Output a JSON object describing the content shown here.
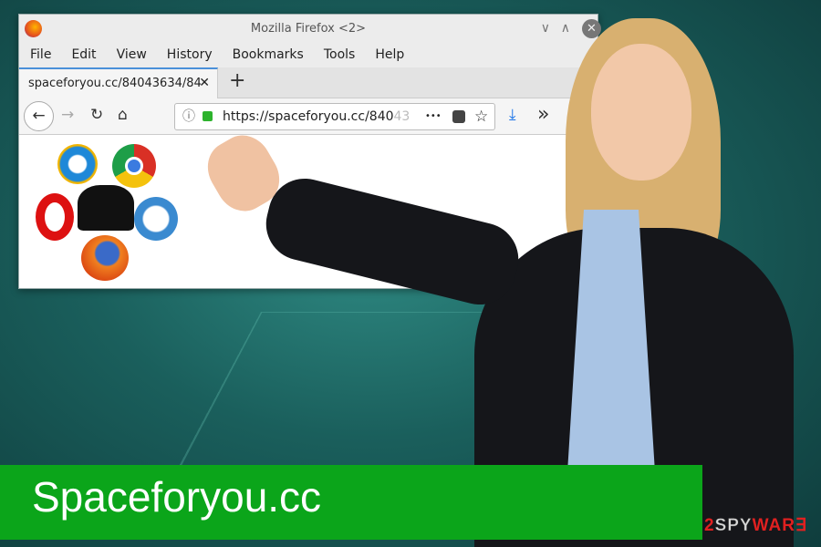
{
  "window": {
    "title": "Mozilla Firefox <2>",
    "min": "∨",
    "max": "∧",
    "close": "✕"
  },
  "menu": [
    "File",
    "Edit",
    "View",
    "History",
    "Bookmarks",
    "Tools",
    "Help"
  ],
  "tab": {
    "label": "spaceforyou.cc/84043634/84",
    "close": "✕",
    "new": "+"
  },
  "nav": {
    "back": "←",
    "forward": "→",
    "reload": "↻",
    "home": "⌂",
    "url": "https://spaceforyou.cc/840",
    "url_faded": "43",
    "more": "•••",
    "star": "☆",
    "download": "⤓",
    "overflow": "»",
    "info": "ⓘ"
  },
  "banner": {
    "title": "Spaceforyou.cc"
  },
  "watermark": {
    "prefix": "2",
    "mid": "SPY",
    "suffix": "WAR∃"
  },
  "colors": {
    "banner": "#0ba51a",
    "accent": "#e02020"
  }
}
